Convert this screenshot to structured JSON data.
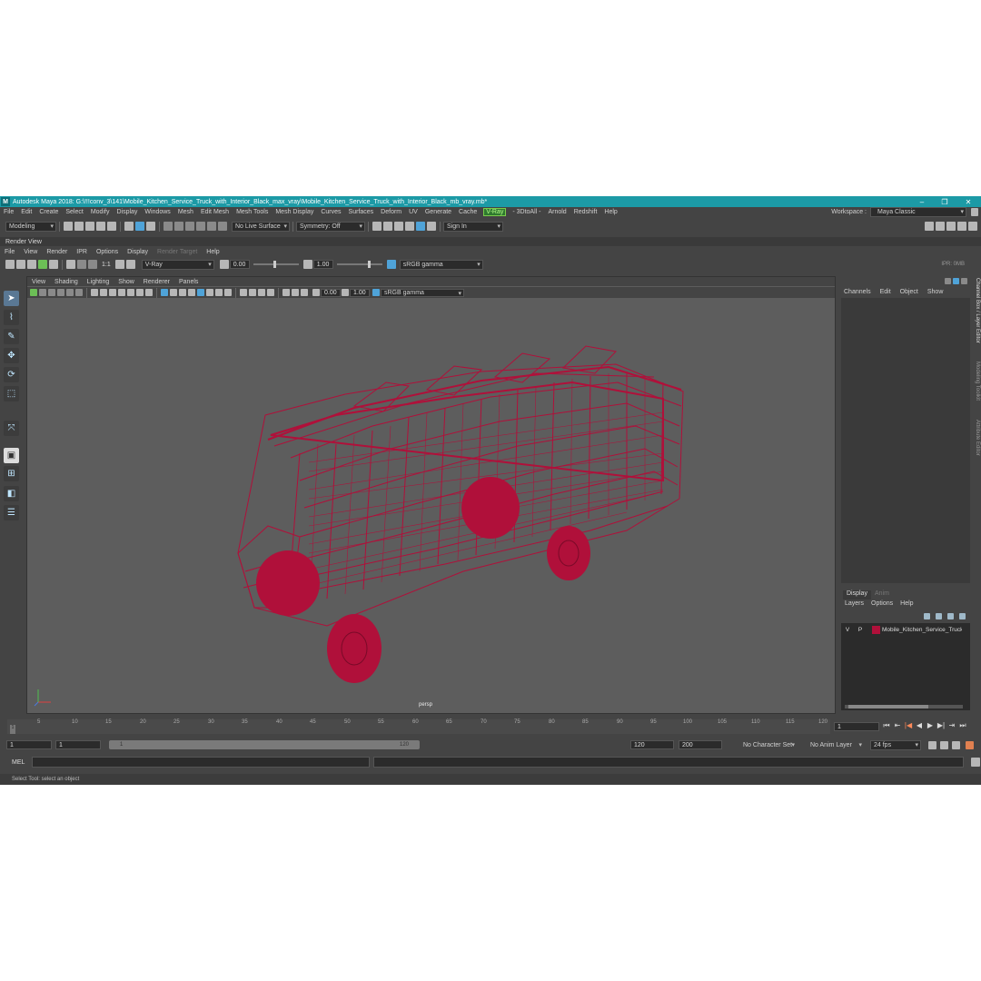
{
  "window": {
    "title": "Autodesk Maya 2018: G:\\!!!conv_3\\141\\Mobile_Kitchen_Service_Truck_with_Interior_Black_max_vray\\Mobile_Kitchen_Service_Truck_with_Interior_Black_mb_vray.mb*",
    "logo": "M"
  },
  "menubar": {
    "items": [
      "File",
      "Edit",
      "Create",
      "Select",
      "Modify",
      "Display",
      "Windows",
      "Mesh",
      "Edit Mesh",
      "Mesh Tools",
      "Mesh Display",
      "Curves",
      "Surfaces",
      "Deform",
      "UV",
      "Generate",
      "Cache"
    ],
    "vray_label": "V-Ray",
    "items2": [
      "- 3DtoAll -",
      "Arnold",
      "Redshift",
      "Help"
    ],
    "workspace_label": "Workspace :",
    "workspace_value": "Maya Classic"
  },
  "shelf": {
    "mode": "Modeling",
    "live_surface": "No Live Surface",
    "symmetry": "Symmetry: Off",
    "sign_in": "Sign In"
  },
  "render_view": {
    "title": "Render View",
    "menu": [
      "File",
      "View",
      "Render",
      "IPR",
      "Options",
      "Display"
    ],
    "menu_disabled": "Render Target",
    "menu_help": "Help",
    "ratio": "1:1",
    "renderer": "V-Ray",
    "exposure": "0.00",
    "gamma": "1.00",
    "colorspace": "sRGB gamma",
    "ipr_status": "IPR: 0MB"
  },
  "panel": {
    "menu": [
      "View",
      "Shading",
      "Lighting",
      "Show",
      "Renderer",
      "Panels"
    ],
    "exposure": "0.00",
    "gamma": "1.00",
    "colorspace": "sRGB gamma",
    "camera": "persp"
  },
  "channel_box": {
    "menu": [
      "Channels",
      "Edit",
      "Object",
      "Show"
    ],
    "side_tabs": [
      "Channel Box / Layer Editor",
      "Modeling Toolkit",
      "Attribute Editor"
    ]
  },
  "layer_editor": {
    "tabs": [
      "Display",
      "Anim"
    ],
    "menu": [
      "Layers",
      "Options",
      "Help"
    ],
    "layer": {
      "v": "V",
      "p": "P",
      "name": "Mobile_Kitchen_Service_Truck_",
      "color": "#b0103a"
    }
  },
  "timeline": {
    "ticks": [
      "5",
      "10",
      "15",
      "20",
      "25",
      "30",
      "35",
      "40",
      "45",
      "50",
      "55",
      "60",
      "65",
      "70",
      "75",
      "80",
      "85",
      "90",
      "95",
      "100",
      "105",
      "110",
      "115",
      "120"
    ],
    "first_tick": "1",
    "current_frame": "1"
  },
  "range": {
    "start": "1",
    "playback_start": "1",
    "slider_start": "1",
    "slider_end": "120",
    "playback_end": "120",
    "end": "200",
    "character_set": "No Character Set",
    "anim_layer": "No Anim Layer",
    "fps": "24 fps"
  },
  "command_line": {
    "label": "MEL",
    "help": "Select Tool: select an object"
  },
  "colors": {
    "wireframe": "#b0103a",
    "title_bar": "#1c9aa6",
    "viewport_bg": "#5d5d5d"
  }
}
